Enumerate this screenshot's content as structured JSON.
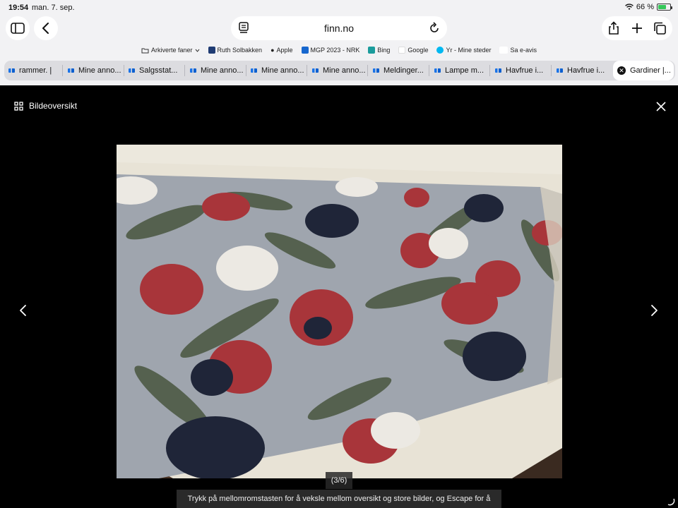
{
  "status": {
    "time": "19:54",
    "date": "man. 7. sep.",
    "battery": "66 %",
    "battery_level": 0.66
  },
  "url": "finn.no",
  "bookmarks": [
    {
      "label": "Arkiverte faner",
      "icon": "folder-icon"
    },
    {
      "label": "Ruth Solbakken",
      "icon": "grid-favicon"
    },
    {
      "label": "Apple",
      "icon": "apple-icon"
    },
    {
      "label": "MGP 2023 - NRK",
      "icon": "nrk-favicon"
    },
    {
      "label": "Bing",
      "icon": "bing-favicon"
    },
    {
      "label": "Google",
      "icon": "google-favicon"
    },
    {
      "label": "Yr - Mine steder",
      "icon": "yr-favicon"
    },
    {
      "label": "Sa e-avis",
      "icon": "sa-favicon"
    }
  ],
  "tabs": [
    {
      "label": "rammer. |"
    },
    {
      "label": "Mine anno..."
    },
    {
      "label": "Salgsstat..."
    },
    {
      "label": "Mine anno..."
    },
    {
      "label": "Mine anno..."
    },
    {
      "label": "Mine anno..."
    },
    {
      "label": "Meldinger..."
    },
    {
      "label": "Lampe m..."
    },
    {
      "label": "Havfrue i..."
    },
    {
      "label": "Havfrue i..."
    },
    {
      "label": "Gardiner |..."
    }
  ],
  "viewer": {
    "overview_label": "Bildeoversikt",
    "counter": "(3/6)",
    "hint": "Trykk på mellomromstasten for å veksle mellom oversikt og store bilder, og Escape for å lukke."
  },
  "colors": {
    "accent": "#1a73e8",
    "background": "#000000",
    "chrome": "#f2f2f4"
  }
}
